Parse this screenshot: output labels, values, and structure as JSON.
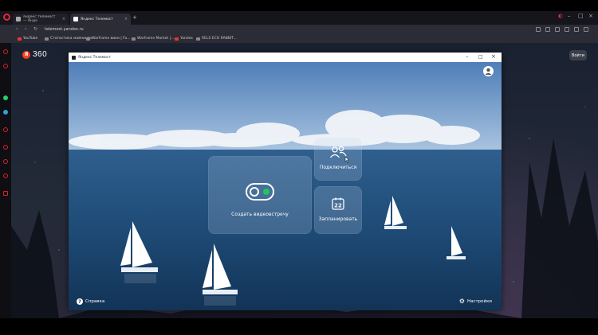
{
  "browser": {
    "tabs": [
      {
        "label": "яндекс телемост — Янде"
      },
      {
        "label": "Яндекс Телемост"
      }
    ],
    "url": "telemost.yandex.ru",
    "bookmarks": [
      "YouTube",
      "Статистика майнинга",
      "Warframe вики | Fa...",
      "Warframe Market |...",
      "Yandex",
      "RELS ECO RABBIT..."
    ]
  },
  "background_site": {
    "logo_text": "360",
    "logo_badge": "Я",
    "login_label": "Войти"
  },
  "telemost_window": {
    "title": "Яндекс Телемост",
    "create_label": "Создать видеовстречу",
    "join_label": "Подключиться",
    "plan_label": "Запланировать",
    "calendar_day": "22",
    "help_label": "Справка",
    "settings_label": "Настройки"
  },
  "colors": {
    "accent_green": "#22c55e",
    "opera_red": "#e0283b",
    "yandex_red": "#fc3f1d"
  }
}
